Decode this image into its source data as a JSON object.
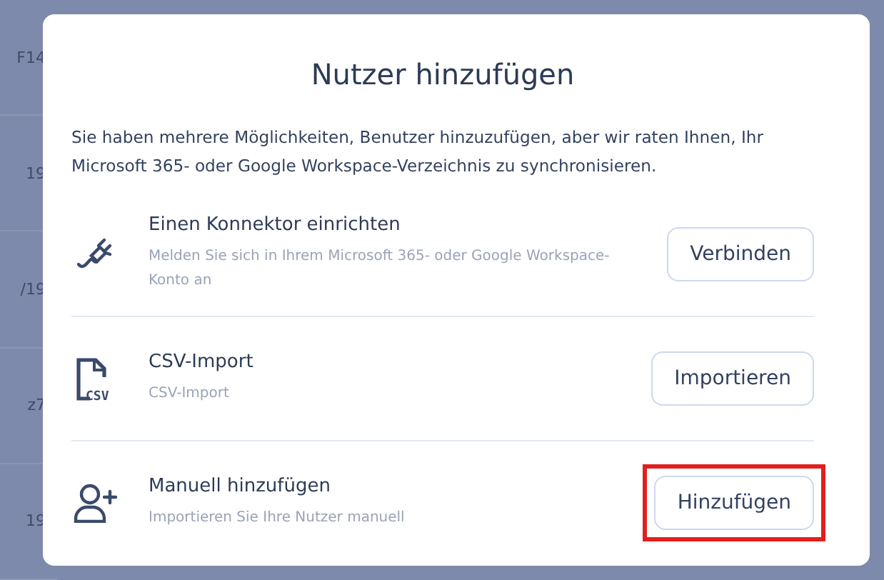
{
  "background_column": [
    "F14",
    "19",
    "/19",
    "z7",
    "19"
  ],
  "dialog": {
    "title": "Nutzer hinzufügen",
    "intro": "Sie haben mehrere Möglichkeiten, Benutzer hinzuzufügen, aber wir raten Ihnen, Ihr Microsoft 365- oder Google Workspace-Verzeichnis zu synchronisieren.",
    "options": [
      {
        "kind": "connector",
        "title": "Einen Konnektor einrichten",
        "description": "Melden Sie sich in Ihrem Microsoft 365- oder Google Workspace-Konto an",
        "button": "Verbinden",
        "highlighted": false
      },
      {
        "kind": "csv",
        "icon_text": "CSV",
        "title": "CSV-Import",
        "description": "CSV-Import",
        "button": "Importieren",
        "highlighted": false
      },
      {
        "kind": "manual",
        "title": "Manuell hinzufügen",
        "description": "Importieren Sie Ihre Nutzer manuell",
        "button": "Hinzufügen",
        "highlighted": true
      }
    ]
  }
}
